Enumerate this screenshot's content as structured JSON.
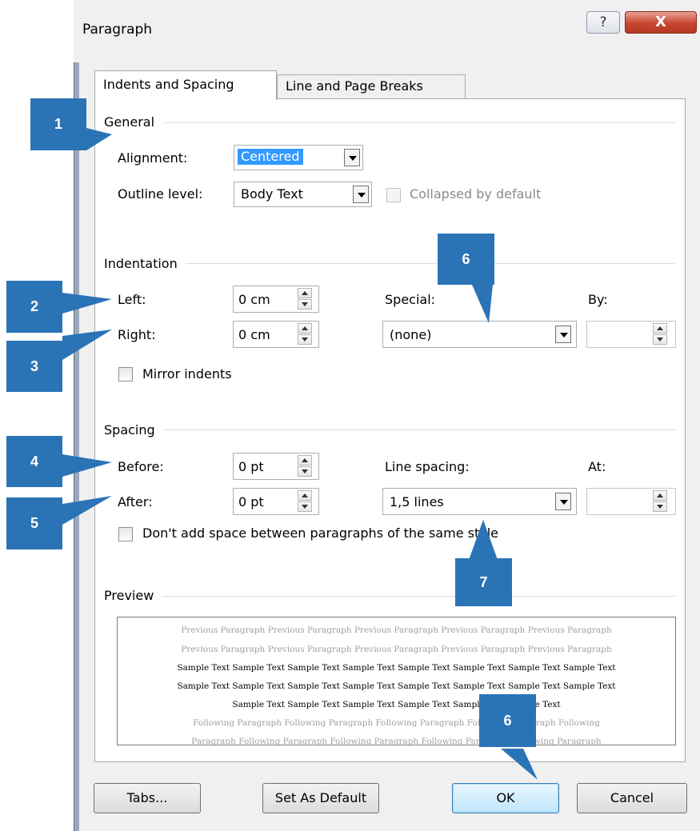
{
  "window": {
    "title": "Paragraph",
    "help_glyph": "?",
    "close_glyph": "X"
  },
  "tabs": [
    {
      "label": "Indents and Spacing",
      "active": true
    },
    {
      "label": "Line and Page Breaks",
      "active": false
    }
  ],
  "general": {
    "title": "General",
    "alignment_label": "Alignment:",
    "alignment_value": "Centered",
    "outline_label": "Outline level:",
    "outline_value": "Body Text",
    "collapsed_label": "Collapsed by default"
  },
  "indentation": {
    "title": "Indentation",
    "left_label": "Left:",
    "left_value": "0 cm",
    "right_label": "Right:",
    "right_value": "0 cm",
    "special_label": "Special:",
    "special_value": "(none)",
    "by_label": "By:",
    "mirror_label": "Mirror indents"
  },
  "spacing": {
    "title": "Spacing",
    "before_label": "Before:",
    "before_value": "0 pt",
    "after_label": "After:",
    "after_value": "0 pt",
    "line_spacing_label": "Line spacing:",
    "line_spacing_value": "1,5 lines",
    "at_label": "At:",
    "dont_add_label": "Don't add space between paragraphs of the same style"
  },
  "preview": {
    "title": "Preview",
    "lines": [
      "Previous Paragraph Previous Paragraph Previous Paragraph Previous Paragraph Previous Paragraph",
      "Previous Paragraph Previous Paragraph Previous Paragraph Previous Paragraph Previous Paragraph",
      "Sample Text Sample Text Sample Text Sample Text Sample Text Sample Text Sample Text Sample Text",
      "Sample Text Sample Text Sample Text Sample Text Sample Text Sample Text Sample Text Sample Text",
      "Sample Text Sample Text Sample Text Sample Text Sample Text Sample Text",
      "Following Paragraph Following Paragraph Following Paragraph Following Paragraph Following",
      "Paragraph Following Paragraph Following Paragraph Following Paragraph Following Paragraph"
    ]
  },
  "buttons": {
    "tabs": "Tabs...",
    "set_default": "Set As Default",
    "ok": "OK",
    "cancel": "Cancel"
  },
  "callouts": [
    "1",
    "2",
    "3",
    "4",
    "5",
    "6",
    "7",
    "6"
  ],
  "colors": {
    "callout": "#2a74b6",
    "selection": "#3399ff"
  }
}
